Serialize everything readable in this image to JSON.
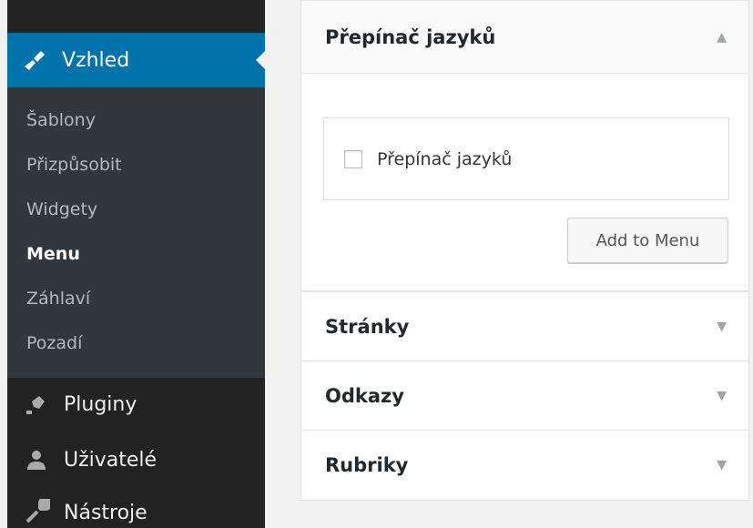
{
  "sidebar": {
    "active_menu": {
      "label": "Vzhled",
      "icon": "paintbrush-icon"
    },
    "submenu": [
      {
        "label": "Šablony",
        "current": false
      },
      {
        "label": "Přizpůsobit",
        "current": false
      },
      {
        "label": "Widgety",
        "current": false
      },
      {
        "label": "Menu",
        "current": true
      },
      {
        "label": "Záhlaví",
        "current": false
      },
      {
        "label": "Pozadí",
        "current": false
      }
    ],
    "items": [
      {
        "label": "Pluginy",
        "icon": "plugin-icon"
      },
      {
        "label": "Uživatelé",
        "icon": "users-icon"
      },
      {
        "label": "Nástroje",
        "icon": "wrench-icon"
      }
    ]
  },
  "panels": {
    "language_switcher": {
      "title": "Přepínač jazyků",
      "checkbox_label": "Přepínač jazyků",
      "checkbox_checked": false,
      "add_button": "Add to Menu"
    },
    "pages": {
      "title": "Stránky"
    },
    "links": {
      "title": "Odkazy"
    },
    "categories": {
      "title": "Rubriky"
    }
  },
  "colors": {
    "accent": "#0073aa",
    "sidebar_bg": "#222222",
    "submenu_bg": "#32373c"
  }
}
